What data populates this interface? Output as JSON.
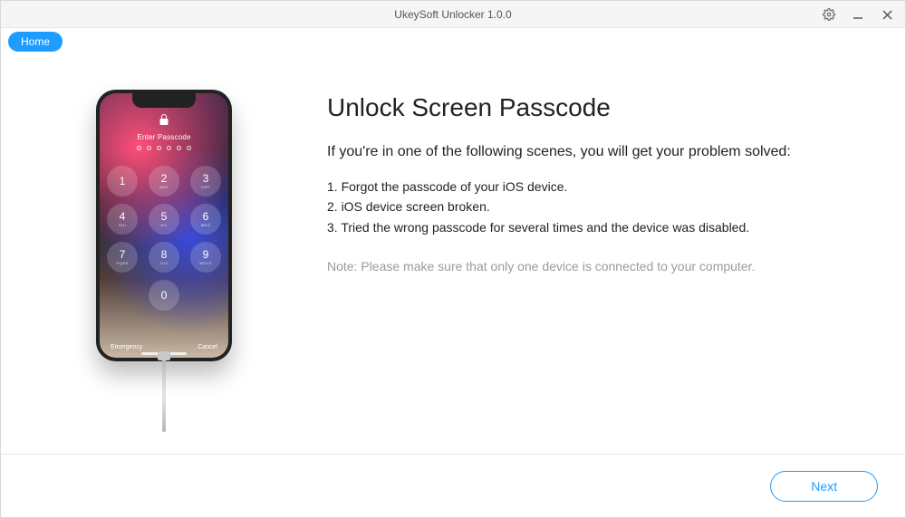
{
  "titlebar": {
    "title": "UkeySoft Unlocker 1.0.0"
  },
  "breadcrumb": {
    "home": "Home"
  },
  "main": {
    "heading": "Unlock Screen Passcode",
    "subtitle": "If you're in one of the following scenes, you will get your problem solved:",
    "items": [
      "1. Forgot the passcode of your iOS device.",
      "2. iOS device screen broken.",
      "3. Tried the wrong passcode for several times and the device was disabled."
    ],
    "note": "Note: Please make sure that only one device is connected to your computer."
  },
  "phone": {
    "enter_passcode": "Enter Passcode",
    "emergency": "Emergency",
    "cancel": "Cancel",
    "keys": [
      {
        "num": "1",
        "let": ""
      },
      {
        "num": "2",
        "let": "ABC"
      },
      {
        "num": "3",
        "let": "DEF"
      },
      {
        "num": "4",
        "let": "GHI"
      },
      {
        "num": "5",
        "let": "JKL"
      },
      {
        "num": "6",
        "let": "MNO"
      },
      {
        "num": "7",
        "let": "PQRS"
      },
      {
        "num": "8",
        "let": "TUV"
      },
      {
        "num": "9",
        "let": "WXYZ"
      },
      {
        "num": "",
        "let": ""
      },
      {
        "num": "0",
        "let": ""
      },
      {
        "num": "",
        "let": ""
      }
    ]
  },
  "footer": {
    "next": "Next"
  }
}
